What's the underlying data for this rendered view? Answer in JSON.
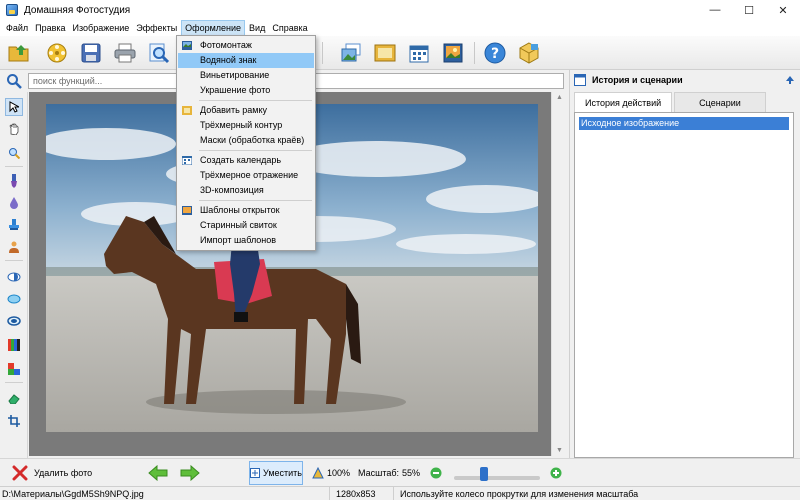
{
  "window": {
    "title": "Домашняя Фотостудия",
    "minimize": "—",
    "maximize": "☐",
    "close": "✕"
  },
  "menubar": {
    "items": [
      "Файл",
      "Правка",
      "Изображение",
      "Эффекты",
      "Оформление",
      "Вид",
      "Справка"
    ],
    "active": "Оформление"
  },
  "dropdown": {
    "items": [
      {
        "label": "Фотомонтаж",
        "icon": "photomontage-icon"
      },
      {
        "label": "Водяной знак",
        "highlighted": true
      },
      {
        "label": "Виньетирование"
      },
      {
        "label": "Украшение фото"
      },
      {
        "label": "Добавить рамку",
        "icon": "frame-icon"
      },
      {
        "label": "Трёхмерный контур"
      },
      {
        "label": "Маски (обработка краёв)"
      },
      {
        "label": "Создать календарь",
        "icon": "calendar-icon"
      },
      {
        "label": "Трёхмерное отражение"
      },
      {
        "label": "3D-композиция"
      },
      {
        "label": "Шаблоны открыток",
        "icon": "postcard-icon"
      },
      {
        "label": "Старинный свиток"
      },
      {
        "label": "Импорт шаблонов"
      }
    ]
  },
  "search": {
    "placeholder": "поиск функций..."
  },
  "right_panel": {
    "title": "История и сценарии",
    "tabs": [
      "История действий",
      "Сценарии"
    ],
    "active_tab": "История действий",
    "history_items": [
      "Исходное изображение"
    ]
  },
  "bottombar": {
    "delete_label": "Удалить фото",
    "fit_label": "Уместить",
    "zoom100_label": "100%",
    "zoom_label": "Масштаб:",
    "zoom_value": "55%",
    "zoom_slider_fraction": 0.35
  },
  "statusbar": {
    "path": "D:\\Материалы\\GgdM5Sh9NPQ.jpg",
    "dimensions": "1280x853",
    "hint": "Используйте колесо прокрутки для изменения масштаба"
  },
  "colors": {
    "accent": "#3b7fd6",
    "menu_highlight": "#91c9f7",
    "canvas_bg": "#7a7a7a"
  }
}
